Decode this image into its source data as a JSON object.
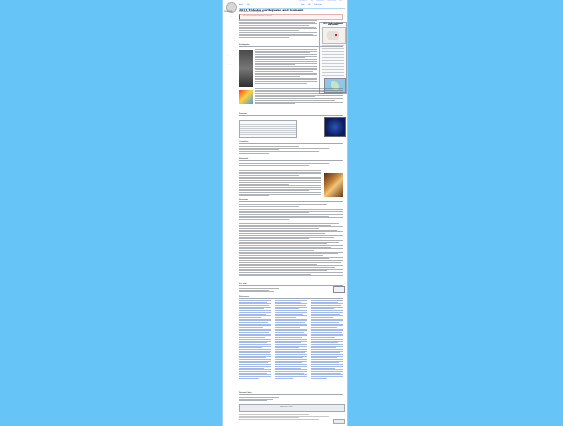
{
  "window": {
    "background_color": "#66c4f7"
  },
  "site": {
    "logo_text": "WIKIPEDIA"
  },
  "header": {
    "top_links": [
      "Not logged in",
      "Talk",
      "Contributions",
      "Create account",
      "Log in"
    ],
    "tabs": [
      "Article",
      "Talk",
      "Read",
      "Edit",
      "View history"
    ],
    "search_placeholder": "Search Wikipedia"
  },
  "sidebar": {
    "items": [
      "Main page",
      "Contents",
      "Current events",
      "Random article",
      "About Wikipedia",
      "Contact us",
      "Donate",
      "Help",
      "Learn to edit",
      "Community portal",
      "Recent changes",
      "Upload file",
      "What links here",
      "Related changes",
      "Special pages",
      "Permanent link",
      "Page information",
      "Cite this page",
      "Download as PDF",
      "Printable version",
      "Languages"
    ]
  },
  "article": {
    "title": "2011 Tōhoku earthquake and tsunami",
    "subtitle": "From Wikipedia, the free encyclopedia",
    "notice": "This article is about the earthquake and tsunami.",
    "infobox_title": "2011 Tōhoku earthquake and tsunami",
    "section_headings": [
      "Earthquake",
      "Tsunami",
      "Casualties",
      "Aftermath",
      "Reactions",
      "See also",
      "References",
      "External links"
    ]
  },
  "colors": {
    "link": "#3366cc",
    "border": "#a2a9b1",
    "notice_border": "#d33333"
  },
  "footer": {
    "navbox": "Earthquakes in Japan"
  }
}
